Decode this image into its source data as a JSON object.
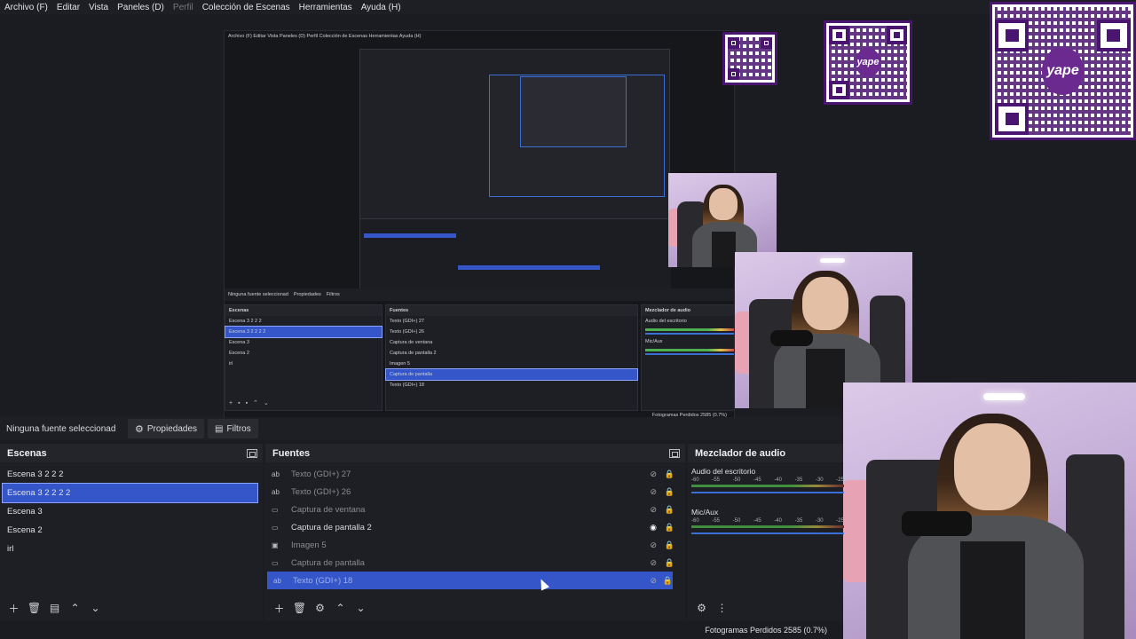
{
  "menu": [
    {
      "label": "Archivo (F)",
      "enabled": true
    },
    {
      "label": "Editar",
      "enabled": true
    },
    {
      "label": "Vista",
      "enabled": true
    },
    {
      "label": "Paneles (D)",
      "enabled": true
    },
    {
      "label": "Perfil",
      "enabled": false
    },
    {
      "label": "Colección de Escenas",
      "enabled": true
    },
    {
      "label": "Herramientas",
      "enabled": true
    },
    {
      "label": "Ayuda (H)",
      "enabled": true
    }
  ],
  "properties_bar": {
    "no_source": "Ninguna fuente seleccionad",
    "properties_tab": "Propiedades",
    "filters_tab": "Filtros"
  },
  "scenes": {
    "title": "Escenas",
    "items": [
      "Escena 3 2 2 2",
      "Escena 3 2 2 2 2",
      "Escena 3",
      "Escena 2",
      "irl"
    ],
    "selected_index": 1
  },
  "sources": {
    "title": "Fuentes",
    "items": [
      {
        "label": "Texto (GDI+) 27",
        "icon": "text-icon",
        "visible": false
      },
      {
        "label": "Texto (GDI+) 26",
        "icon": "text-icon",
        "visible": false
      },
      {
        "label": "Captura de ventana",
        "icon": "window-icon",
        "visible": false
      },
      {
        "label": "Captura de pantalla 2",
        "icon": "monitor-icon",
        "visible": true
      },
      {
        "label": "Imagen 5",
        "icon": "image-icon",
        "visible": false
      },
      {
        "label": "Captura de pantalla",
        "icon": "monitor-icon",
        "visible": false
      },
      {
        "label": "Texto (GDI+) 18",
        "icon": "text-icon",
        "visible": false
      }
    ],
    "selected_index": 6
  },
  "mixer": {
    "title": "Mezclador de audio",
    "channels": [
      {
        "name": "Audio del escritorio",
        "ticks": [
          "-60",
          "-55",
          "-50",
          "-45",
          "-40",
          "-35",
          "-30",
          "-25"
        ]
      },
      {
        "name": "Mic/Aux",
        "ticks": [
          "-60",
          "-55",
          "-50",
          "-45",
          "-40",
          "-35",
          "-30",
          "-25"
        ]
      }
    ]
  },
  "status": {
    "dropped_frames": "Fotogramas Perdidos 2585 (0.7%)"
  },
  "nested_preview": {
    "menu": "Archivo (F)   Editar   Vista   Paneles (D)   Perfil   Colección de Escenas   Herramientas   Ayuda (H)",
    "status_no_source": "Ninguna fuente seleccionad",
    "properties": "Propiedades",
    "filters": "Filtros",
    "scenes_title": "Escenas",
    "scenes": [
      "Escena 3 2 2 2",
      "Escena 3 2 2 2 2",
      "Escena 3",
      "Escena 2",
      "irl"
    ],
    "sources_title": "Fuentes",
    "sources": [
      "Texto (GDI+) 27",
      "Texto (GDI+) 26",
      "Captura de ventana",
      "Captura de pantalla 2",
      "Imagen 5",
      "Captura de pantalla",
      "Texto (GDI+) 18"
    ],
    "mixer_title": "Mezclador de audio",
    "mixer_desktop": "Audio del escritorio",
    "mixer_mic": "Mic/Aux",
    "dropped": "Fotogramas Perdidos 2585 (0.7%)"
  },
  "qr_logo_text": "yape",
  "colors": {
    "accent": "#3556c9",
    "qr_purple": "#4a1570"
  }
}
